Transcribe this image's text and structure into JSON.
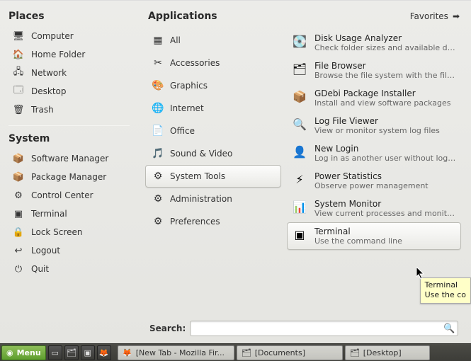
{
  "places": {
    "title": "Places",
    "items": [
      {
        "label": "Computer",
        "icon": "🖥"
      },
      {
        "label": "Home Folder",
        "icon": "🏠"
      },
      {
        "label": "Network",
        "icon": "🖧"
      },
      {
        "label": "Desktop",
        "icon": "🗔"
      },
      {
        "label": "Trash",
        "icon": "🗑"
      }
    ]
  },
  "system": {
    "title": "System",
    "items": [
      {
        "label": "Software Manager",
        "icon": "📦"
      },
      {
        "label": "Package Manager",
        "icon": "📦"
      },
      {
        "label": "Control Center",
        "icon": "⚙"
      },
      {
        "label": "Terminal",
        "icon": "▣"
      },
      {
        "label": "Lock Screen",
        "icon": "🔒"
      },
      {
        "label": "Logout",
        "icon": "↩"
      },
      {
        "label": "Quit",
        "icon": "⏻"
      }
    ]
  },
  "apps": {
    "title": "Applications",
    "favorites": "Favorites",
    "categories": [
      {
        "label": "All",
        "icon": "▦"
      },
      {
        "label": "Accessories",
        "icon": "✂"
      },
      {
        "label": "Graphics",
        "icon": "🎨"
      },
      {
        "label": "Internet",
        "icon": "🌐"
      },
      {
        "label": "Office",
        "icon": "📄"
      },
      {
        "label": "Sound & Video",
        "icon": "🎵"
      },
      {
        "label": "System Tools",
        "icon": "⚙",
        "selected": true
      },
      {
        "label": "Administration",
        "icon": "⚙"
      },
      {
        "label": "Preferences",
        "icon": "⚙"
      }
    ],
    "list": [
      {
        "name": "Disk Usage Analyzer",
        "desc": "Check folder sizes and available disk sp...",
        "icon": "💽"
      },
      {
        "name": "File Browser",
        "desc": "Browse the file system with the file ma...",
        "icon": "🗂"
      },
      {
        "name": "GDebi Package Installer",
        "desc": "Install and view software packages",
        "icon": "📦"
      },
      {
        "name": "Log File Viewer",
        "desc": "View or monitor system log files",
        "icon": "🔍"
      },
      {
        "name": "New Login",
        "desc": "Log in as another user without logging ...",
        "icon": "👤"
      },
      {
        "name": "Power Statistics",
        "desc": "Observe power management",
        "icon": "⚡"
      },
      {
        "name": "System Monitor",
        "desc": "View current processes and monitor sys...",
        "icon": "📊"
      },
      {
        "name": "Terminal",
        "desc": "Use the command line",
        "icon": "▣",
        "hover": true
      }
    ]
  },
  "search": {
    "label": "Search:",
    "value": ""
  },
  "tooltip": {
    "title": "Terminal",
    "desc": "Use the co"
  },
  "taskbar": {
    "menu": "Menu",
    "tasks": [
      {
        "label": "[New Tab - Mozilla Fir...",
        "icon": "🦊"
      },
      {
        "label": "[Documents]",
        "icon": "🗂"
      },
      {
        "label": "[Desktop]",
        "icon": "🗂"
      }
    ]
  }
}
